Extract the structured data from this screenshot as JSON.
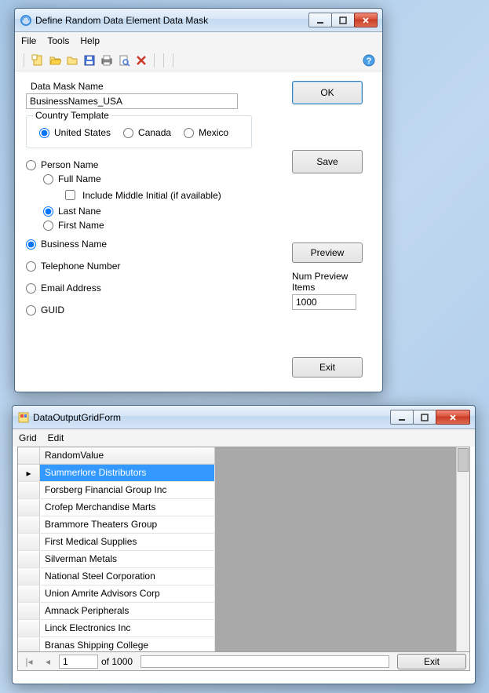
{
  "window1": {
    "title": "Define Random Data Element Data Mask",
    "menu": {
      "file": "File",
      "tools": "Tools",
      "help": "Help"
    },
    "form": {
      "mask_name_label": "Data Mask Name",
      "mask_name_value": "BusinessNames_USA",
      "country_template_label": "Country Template",
      "country": {
        "us": "United States",
        "ca": "Canada",
        "mx": "Mexico"
      },
      "person_name_label": "Person Name",
      "person": {
        "full": "Full Name",
        "include_middle": "Include Middle Initial (if available)",
        "last": "Last Nane",
        "first": "First Name"
      },
      "business_name_label": "Business Name",
      "telephone_label": "Telephone Number",
      "email_label": "Email Address",
      "guid_label": "GUID",
      "num_preview_label": "Num Preview Items",
      "num_preview_value": "1000"
    },
    "buttons": {
      "ok": "OK",
      "save": "Save",
      "preview": "Preview",
      "exit": "Exit"
    }
  },
  "window2": {
    "title": "DataOutputGridForm",
    "menu": {
      "grid": "Grid",
      "edit": "Edit"
    },
    "column_header": "RandomValue",
    "rows": [
      "Summerlore Distributors",
      "Forsberg Financial Group Inc",
      "Crofep Merchandise Marts",
      "Brammore Theaters Group",
      "First Medical Supplies",
      "Silverman Metals",
      "National Steel Corporation",
      "Union Amrite Advisors Corp",
      "Amnack Peripherals",
      "Linck Electronics Inc",
      "Branas Shipping College"
    ],
    "nav": {
      "pos": "1",
      "of_total": "of 1000",
      "exit": "Exit"
    }
  }
}
